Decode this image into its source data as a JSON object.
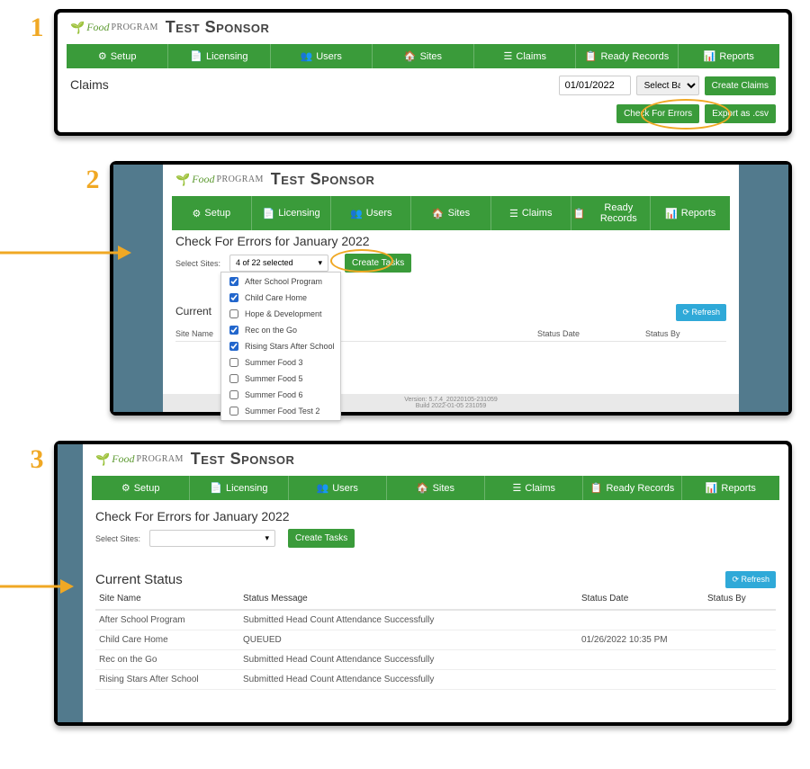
{
  "steps": [
    "1",
    "2",
    "3"
  ],
  "brand": {
    "food": "Food",
    "program": "PROGRAM",
    "sponsor": "Test Sponsor"
  },
  "nav": [
    {
      "icon": "⚙",
      "label": "Setup"
    },
    {
      "icon": "📄",
      "label": "Licensing"
    },
    {
      "icon": "👥",
      "label": "Users"
    },
    {
      "icon": "🏠",
      "label": "Sites"
    },
    {
      "icon": "☰",
      "label": "Claims"
    },
    {
      "icon": "📋",
      "label": "Ready Records"
    },
    {
      "icon": "📊",
      "label": "Reports"
    }
  ],
  "panel1": {
    "title": "Claims",
    "date": "01/01/2022",
    "batch": "Select Batch",
    "btn_create": "Create Claims",
    "btn_check": "Check For Errors",
    "btn_export": "Export as .csv"
  },
  "panel2": {
    "title": "Check For Errors for January 2022",
    "select_label": "Select Sites:",
    "selected_text": "4 of 22 selected",
    "btn_create": "Create Tasks",
    "current_status": "Current",
    "btn_refresh": "Refresh",
    "cols": {
      "site": "Site Name",
      "date": "Status Date",
      "by": "Status By"
    },
    "options": [
      {
        "label": "After School Program",
        "checked": true
      },
      {
        "label": "Child Care Home",
        "checked": true
      },
      {
        "label": "Hope & Development",
        "checked": false
      },
      {
        "label": "Rec on the Go",
        "checked": true
      },
      {
        "label": "Rising Stars After School",
        "checked": true
      },
      {
        "label": "Summer Food 3",
        "checked": false
      },
      {
        "label": "Summer Food 5",
        "checked": false
      },
      {
        "label": "Summer Food 6",
        "checked": false
      },
      {
        "label": "Summer Food Test 2",
        "checked": false
      }
    ],
    "footer_version": "Version: 5.7.4_20220105-231059",
    "footer_build": "Build 2022-01-05 231059"
  },
  "panel3": {
    "title": "Check For Errors for January 2022",
    "select_label": "Select Sites:",
    "btn_create": "Create Tasks",
    "current_status": "Current Status",
    "btn_refresh": "Refresh",
    "cols": {
      "site": "Site Name",
      "msg": "Status Message",
      "date": "Status Date",
      "by": "Status By"
    },
    "rows": [
      {
        "site": "After School Program",
        "msg": "Submitted Head Count Attendance Successfully",
        "date": "",
        "by": ""
      },
      {
        "site": "Child Care Home",
        "msg": "QUEUED",
        "date": "01/26/2022 10:35 PM",
        "by": ""
      },
      {
        "site": "Rec on the Go",
        "msg": "Submitted Head Count Attendance Successfully",
        "date": "",
        "by": ""
      },
      {
        "site": "Rising Stars After School",
        "msg": "Submitted Head Count Attendance Successfully",
        "date": "",
        "by": ""
      }
    ]
  }
}
